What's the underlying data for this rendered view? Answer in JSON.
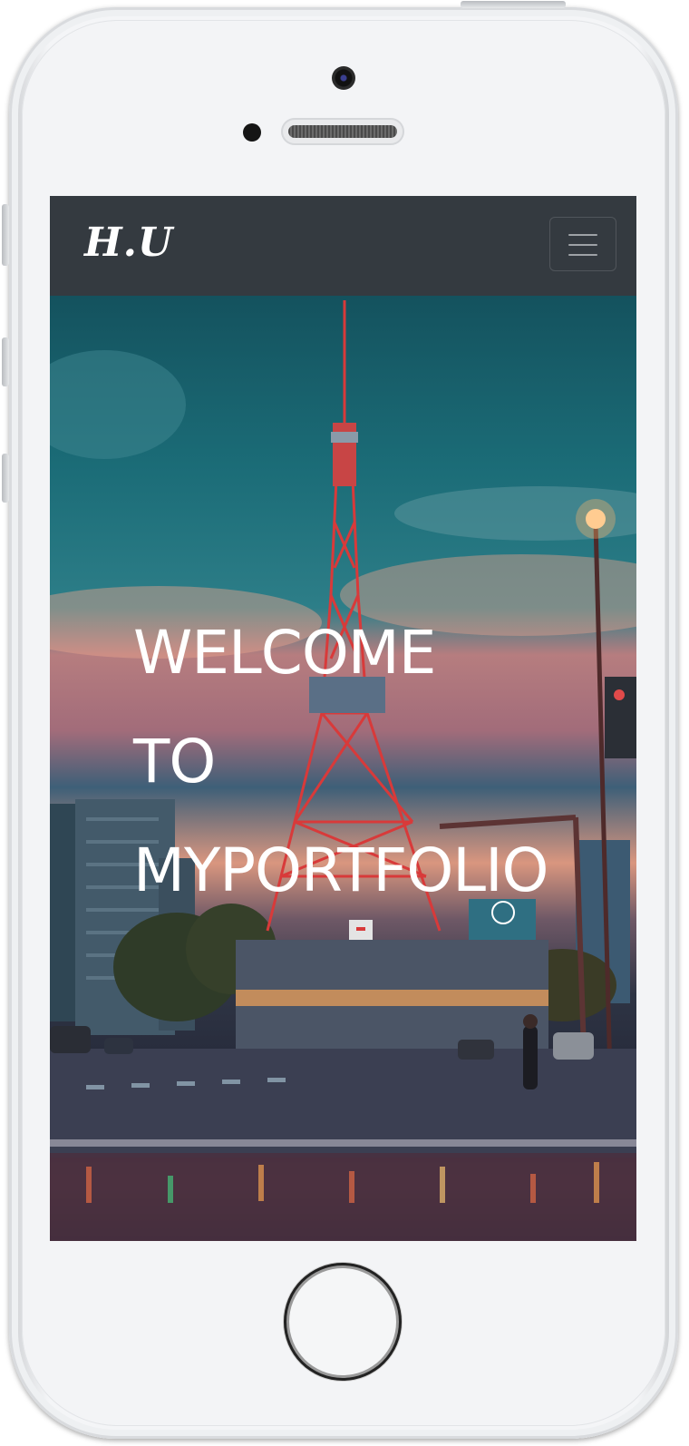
{
  "navbar": {
    "brand": "H.U",
    "toggler_icon": "hamburger-menu-icon"
  },
  "hero": {
    "lines": [
      "WELCOME",
      "TO",
      "MYPORTFOLIO"
    ],
    "background": "photo of a red lattice tower over a city street at dusk"
  },
  "colors": {
    "navbar_bg": "#343a40",
    "hero_text": "#ffffff"
  }
}
